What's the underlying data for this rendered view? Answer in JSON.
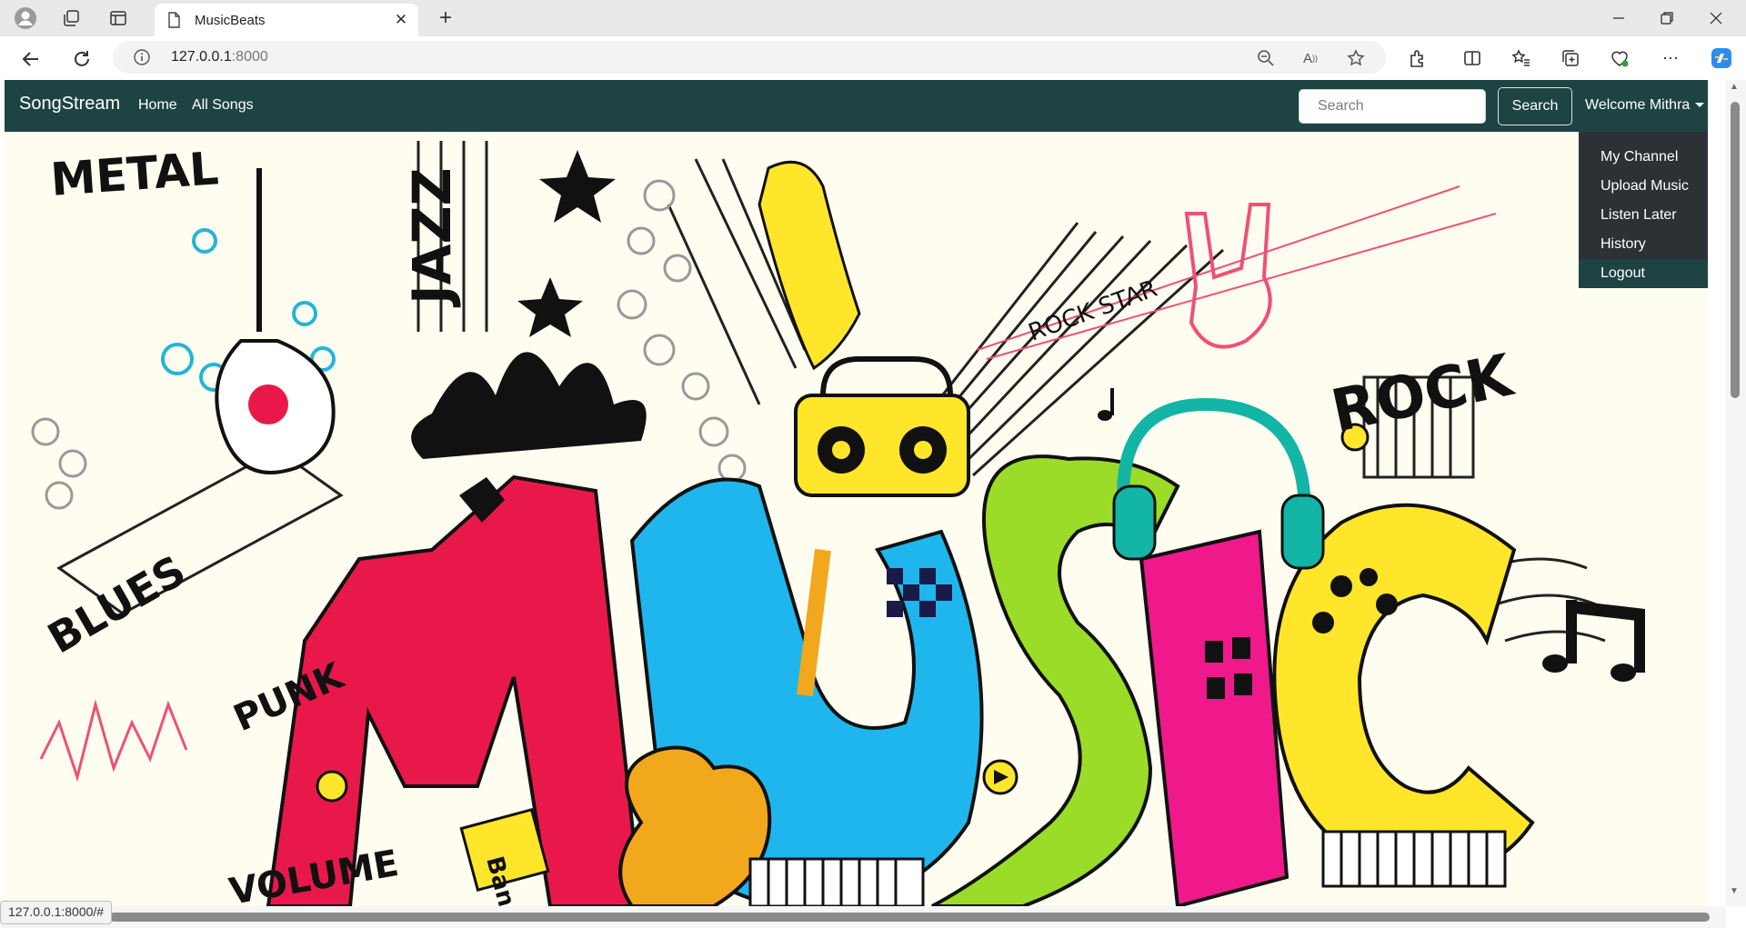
{
  "browser": {
    "tab_title": "MusicBeats",
    "url_host": "127.0.0.1",
    "url_port": ":8000",
    "status_url": "127.0.0.1:8000/#"
  },
  "app": {
    "brand": "SongStream",
    "nav": {
      "home": "Home",
      "all_songs": "All Songs"
    },
    "search": {
      "placeholder": "Search",
      "button": "Search"
    },
    "user_menu": {
      "label": "Welcome Mithra",
      "items": [
        "My Channel",
        "Upload Music",
        "Listen Later",
        "History",
        "Logout"
      ]
    }
  },
  "hero": {
    "title": "MUSIC",
    "words": [
      "METAL",
      "BLUES",
      "PUNK",
      "JAZZ",
      "ROCK",
      "ROCK STAR",
      "Band",
      "VOLUME"
    ]
  },
  "colors": {
    "navbar": "#1e4343",
    "dropdown": "#2d3136",
    "hero_bg": "#fffdf0",
    "music_red": "#e8194a",
    "music_blue": "#1fb6ee",
    "music_green": "#9bdc28",
    "music_pink": "#f0198c",
    "music_yellow": "#ffe62a",
    "headphones_teal": "#12b5a6"
  }
}
